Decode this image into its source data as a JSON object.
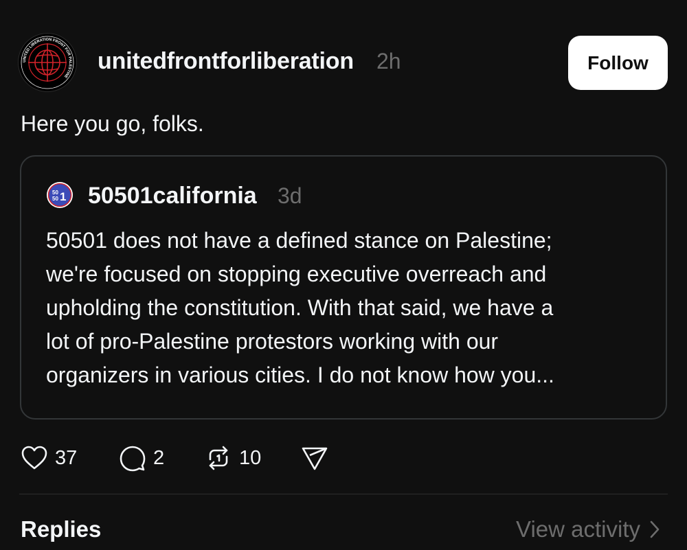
{
  "post": {
    "author": {
      "username": "unitedfrontforliberation",
      "avatar_icon": "globe-logo-icon",
      "avatar_ring_text": "UNITED LIBERATION FRONT FOR PALESTINE"
    },
    "time": "2h",
    "follow_label": "Follow",
    "text": "Here you go, folks."
  },
  "quoted_post": {
    "author": {
      "username": "50501california",
      "avatar_icon": "50501-logo-icon"
    },
    "time": "3d",
    "lines": [
      "50501 does not have a defined stance on Palestine;",
      "we're focused on stopping executive overreach and",
      "upholding the constitution. With that said, we have a",
      "lot of pro-Palestine protestors working with our",
      "organizers in various cities. I do not know how you..."
    ]
  },
  "actions": {
    "like": {
      "icon": "heart-icon",
      "count": "37"
    },
    "reply": {
      "icon": "comment-icon",
      "count": "2"
    },
    "repost": {
      "icon": "repost-icon",
      "count": "10"
    },
    "share": {
      "icon": "send-icon"
    }
  },
  "footer": {
    "replies_label": "Replies",
    "view_activity_label": "View activity"
  },
  "colors": {
    "background": "#101010",
    "text": "#f3f5f7",
    "muted": "#6d6d6d",
    "border": "#333638",
    "avatar_red": "#d2232a",
    "logo_blue": "#3c4bb7"
  }
}
